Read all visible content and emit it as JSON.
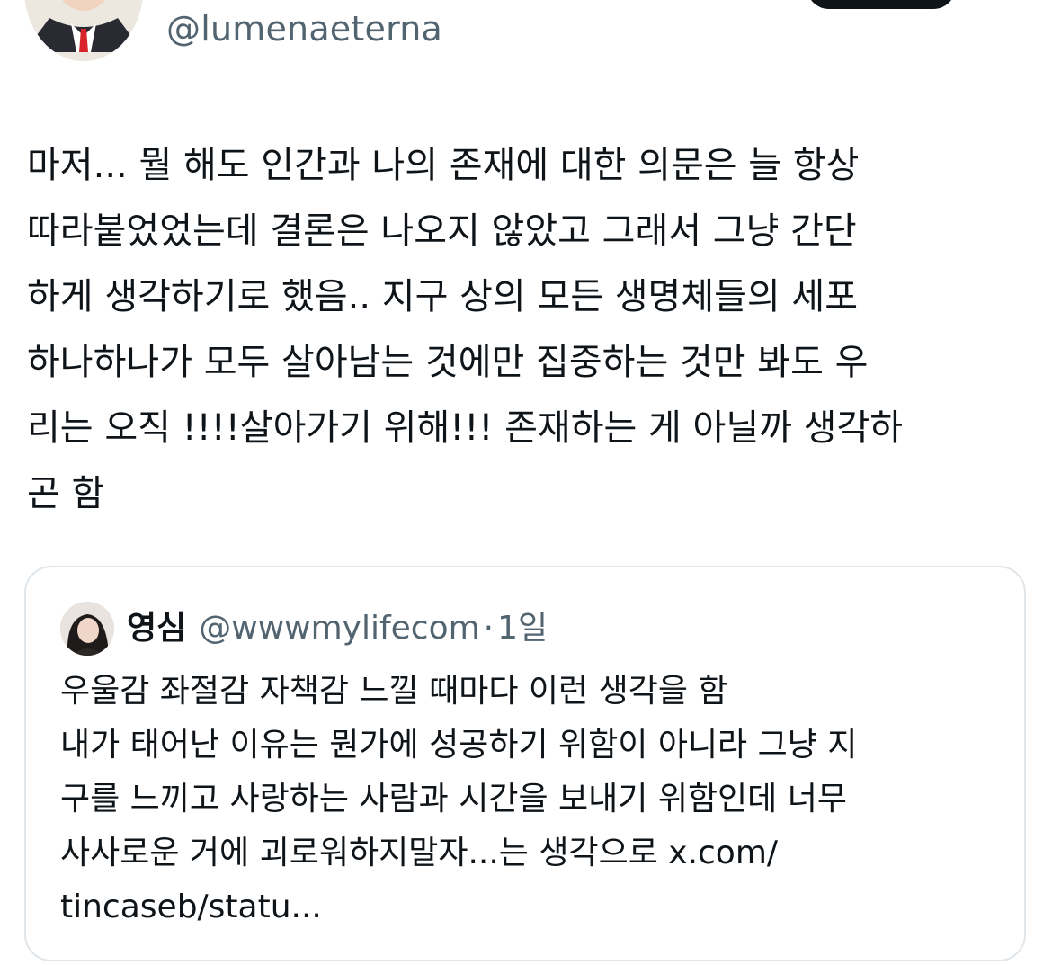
{
  "author": {
    "handle": "@lumenaeterna"
  },
  "tweet": {
    "text": "마저... 뭘 해도 인간과 나의 존재에 대한 의문은 늘 항상\n따라붙었었는데 결론은 나오지 않았고 그래서 그냥 간단\n하게 생각하기로 했음.. 지구 상의 모든 생명체들의 세포\n하나하나가 모두 살아남는 것에만 집중하는  것만 봐도 우\n리는 오직 !!!!살아가기 위해!!! 존재하는 게 아닐까 생각하\n곤 함"
  },
  "quote": {
    "name": "영심",
    "handle": "@wwwmylifecom",
    "separator": "·",
    "time": "1일",
    "text": "우울감 좌절감 자책감 느낄 때마다 이런 생각을 함\n내가 태어난 이유는 뭔가에 성공하기 위함이 아니라 그냥 지\n구를 느끼고 사랑하는 사람과 시간을 보내기 위함인데 너무\n사사로운 거에 괴로워하지말자...는 생각으로 x.com/\ntincaseb/statu..."
  },
  "colors": {
    "text_primary": "#0f1419",
    "text_secondary": "#536471",
    "border": "#e1e6ea"
  }
}
